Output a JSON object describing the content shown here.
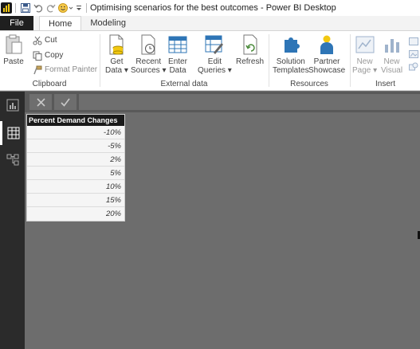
{
  "window": {
    "title": "Optimising scenarios for the best outcomes - Power BI Desktop"
  },
  "tabs": [
    {
      "label": "File"
    },
    {
      "label": "Home"
    },
    {
      "label": "Modeling"
    }
  ],
  "ribbon": {
    "clipboard": {
      "label": "Clipboard",
      "paste": "Paste",
      "cut": "Cut",
      "copy": "Copy",
      "format_painter": "Format Painter"
    },
    "external_data": {
      "label": "External data",
      "get_data": [
        "Get",
        "Data"
      ],
      "recent_sources": [
        "Recent",
        "Sources"
      ],
      "enter_data": [
        "Enter",
        "Data"
      ],
      "edit_queries": [
        "Edit",
        "Queries"
      ],
      "refresh": "Refresh"
    },
    "resources": {
      "label": "Resources",
      "solution_templates": [
        "Solution",
        "Templates"
      ],
      "partner_showcase": [
        "Partner",
        "Showcase"
      ]
    },
    "insert": {
      "label": "Insert",
      "new_page": [
        "New",
        "Page"
      ],
      "new_visual": [
        "New",
        "Visual"
      ]
    }
  },
  "table": {
    "header": "Percent Demand Changes",
    "rows": [
      "-10%",
      "-5%",
      "2%",
      "5%",
      "10%",
      "15%",
      "20%"
    ]
  },
  "colors": {
    "accent_logo": "#f2c811",
    "nav_bg": "#2b2b2b",
    "canvas_bg": "#6d6d6d",
    "file_tab_bg": "#1f1f1f"
  }
}
